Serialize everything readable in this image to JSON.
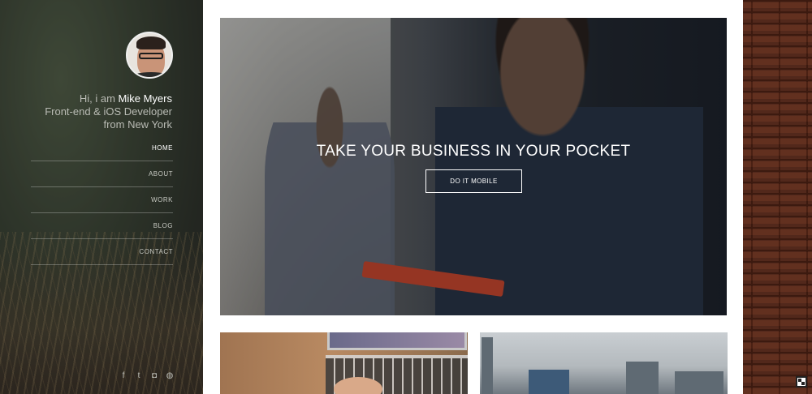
{
  "sidebar": {
    "intro_prefix": "Hi, i am ",
    "name": "Mike Myers",
    "role_line1": "Front-end & iOS Developer",
    "role_line2": "from New York",
    "nav": [
      {
        "label": "HOME",
        "active": true
      },
      {
        "label": "ABOUT",
        "active": false
      },
      {
        "label": "WORK",
        "active": false
      },
      {
        "label": "BLOG",
        "active": false
      },
      {
        "label": "CONTACT",
        "active": false
      }
    ],
    "social": [
      {
        "icon": "facebook-icon",
        "glyph": "f"
      },
      {
        "icon": "twitter-icon",
        "glyph": "t"
      },
      {
        "icon": "instagram-icon",
        "glyph": "◘"
      },
      {
        "icon": "dribbble-icon",
        "glyph": "◍"
      }
    ]
  },
  "hero": {
    "title": "TAKE YOUR BUSINESS IN YOUR POCKET",
    "button_label": "DO IT MOBILE"
  },
  "colors": {
    "sidebar_text": "#b9bbb4",
    "accent_white": "#ffffff",
    "phone_red": "#e04a2c"
  }
}
